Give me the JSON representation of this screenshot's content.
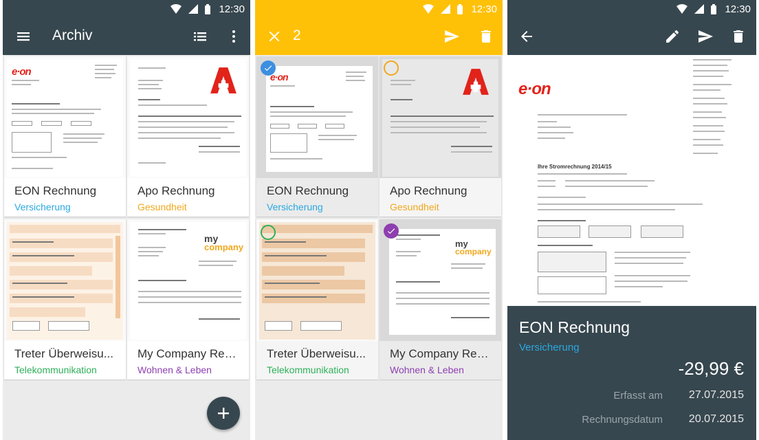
{
  "status_bar": {
    "time": "12:30"
  },
  "colors": {
    "toolbar_dark": "#37474f",
    "toolbar_selection": "#ffc107",
    "versicherung": "#29a8e0",
    "gesundheit": "#f0a81c",
    "telekommunikation": "#2eb05a",
    "wohnen_leben": "#8e3fb0",
    "selected_check": "#3d8fe0",
    "fab": "#37474f"
  },
  "screens": {
    "archive": {
      "title": "Archiv",
      "icons": {
        "menu": "menu-icon",
        "list": "list-view-icon",
        "more": "more-vert-icon",
        "fab": "add-icon"
      }
    },
    "selection": {
      "count": "2",
      "icons": {
        "close": "close-icon",
        "send": "send-icon",
        "delete": "delete-icon"
      }
    },
    "detail": {
      "title": "EON Rechnung",
      "category": "Versicherung",
      "amount": "-29,99 €",
      "erfasst_label": "Erfasst am",
      "erfasst_value": "27.07.2015",
      "rechnungsdatum_label": "Rechnungsdatum",
      "rechnungsdatum_value": "20.07.2015",
      "icons": {
        "back": "arrow-back-icon",
        "edit": "edit-icon",
        "send": "send-icon",
        "delete": "delete-icon"
      }
    }
  },
  "documents": [
    {
      "title": "EON Rechnung",
      "category": "Versicherung"
    },
    {
      "title": "Apo Rechnung",
      "category": "Gesundheit"
    },
    {
      "title": "Treter Überweisu...",
      "category": "Telekommunikation"
    },
    {
      "title": "My Company Rec...",
      "category": "Wohnen & Leben"
    }
  ],
  "thumb_text": {
    "eon": "e·on",
    "mycompany_my": "my",
    "mycompany_company": "company",
    "detail_heading": "Ihre Stromrechnung 2014/15"
  }
}
